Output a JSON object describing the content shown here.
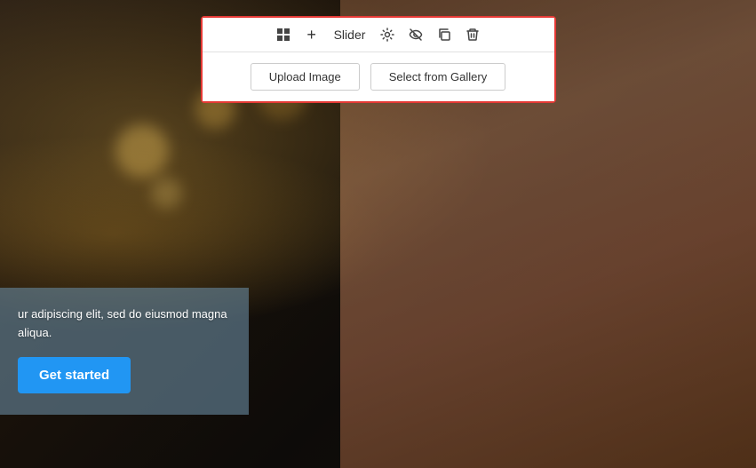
{
  "browser": {
    "bar_visible": true
  },
  "toolbar": {
    "label": "Slider",
    "upload_btn": "Upload Image",
    "gallery_btn": "Select from Gallery",
    "icons": {
      "grid": "grid-icon",
      "add": "+",
      "settings": "⚙",
      "eye_off": "eye-off-icon",
      "copy": "copy-icon",
      "trash": "trash-icon"
    }
  },
  "overlay": {
    "text": "ur adipiscing elit, sed do eiusmod magna aliqua.",
    "cta_label": "Get started"
  },
  "colors": {
    "red_border": "#e53935",
    "cta_blue": "#2196F3",
    "overlay_bg": "rgba(100,130,150,0.65)"
  }
}
